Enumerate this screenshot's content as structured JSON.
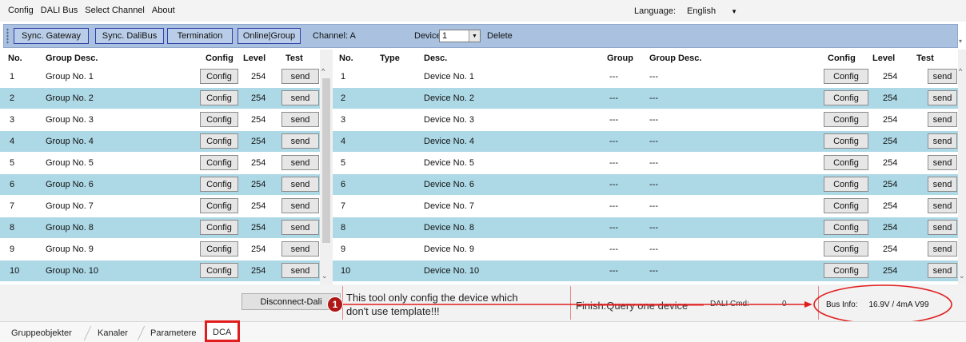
{
  "menu": [
    "Config",
    "DALI Bus",
    "Select Channel",
    "About"
  ],
  "language": {
    "label": "Language:",
    "value": "English"
  },
  "toolbar": {
    "sync_gateway": "Sync. Gateway",
    "sync_dalibus": "Sync. DaliBus",
    "termination": "Termination",
    "online_group": "Online|Group",
    "channel": "Channel:  A",
    "device_label": "Device",
    "device_value": "1",
    "delete": "Delete"
  },
  "groups": {
    "headers": {
      "no": "No.",
      "desc": "Group Desc.",
      "config": "Config",
      "level": "Level",
      "test": "Test"
    },
    "rows": [
      {
        "no": "1",
        "desc": "Group No. 1",
        "config": "Config",
        "level": "254",
        "test": "send"
      },
      {
        "no": "2",
        "desc": "Group No. 2",
        "config": "Config",
        "level": "254",
        "test": "send"
      },
      {
        "no": "3",
        "desc": "Group No. 3",
        "config": "Config",
        "level": "254",
        "test": "send"
      },
      {
        "no": "4",
        "desc": "Group No. 4",
        "config": "Config",
        "level": "254",
        "test": "send"
      },
      {
        "no": "5",
        "desc": "Group No. 5",
        "config": "Config",
        "level": "254",
        "test": "send"
      },
      {
        "no": "6",
        "desc": "Group No. 6",
        "config": "Config",
        "level": "254",
        "test": "send"
      },
      {
        "no": "7",
        "desc": "Group No. 7",
        "config": "Config",
        "level": "254",
        "test": "send"
      },
      {
        "no": "8",
        "desc": "Group No. 8",
        "config": "Config",
        "level": "254",
        "test": "send"
      },
      {
        "no": "9",
        "desc": "Group No. 9",
        "config": "Config",
        "level": "254",
        "test": "send"
      },
      {
        "no": "10",
        "desc": "Group No. 10",
        "config": "Config",
        "level": "254",
        "test": "send"
      }
    ]
  },
  "devices": {
    "headers": {
      "no": "No.",
      "type": "Type",
      "desc": "Desc.",
      "group": "Group",
      "group_desc": "Group Desc.",
      "config": "Config",
      "level": "Level",
      "test": "Test"
    },
    "rows": [
      {
        "no": "1",
        "type": "",
        "desc": "Device No. 1",
        "group": "---",
        "group_desc": "---",
        "config": "Config",
        "level": "254",
        "test": "send"
      },
      {
        "no": "2",
        "type": "",
        "desc": "Device No. 2",
        "group": "---",
        "group_desc": "---",
        "config": "Config",
        "level": "254",
        "test": "send"
      },
      {
        "no": "3",
        "type": "",
        "desc": "Device No. 3",
        "group": "---",
        "group_desc": "---",
        "config": "Config",
        "level": "254",
        "test": "send"
      },
      {
        "no": "4",
        "type": "",
        "desc": "Device No. 4",
        "group": "---",
        "group_desc": "---",
        "config": "Config",
        "level": "254",
        "test": "send"
      },
      {
        "no": "5",
        "type": "",
        "desc": "Device No. 5",
        "group": "---",
        "group_desc": "---",
        "config": "Config",
        "level": "254",
        "test": "send"
      },
      {
        "no": "6",
        "type": "",
        "desc": "Device No. 6",
        "group": "---",
        "group_desc": "---",
        "config": "Config",
        "level": "254",
        "test": "send"
      },
      {
        "no": "7",
        "type": "",
        "desc": "Device No. 7",
        "group": "---",
        "group_desc": "---",
        "config": "Config",
        "level": "254",
        "test": "send"
      },
      {
        "no": "8",
        "type": "",
        "desc": "Device No. 8",
        "group": "---",
        "group_desc": "---",
        "config": "Config",
        "level": "254",
        "test": "send"
      },
      {
        "no": "9",
        "type": "",
        "desc": "Device No. 9",
        "group": "---",
        "group_desc": "---",
        "config": "Config",
        "level": "254",
        "test": "send"
      },
      {
        "no": "10",
        "type": "",
        "desc": "Device No. 10",
        "group": "---",
        "group_desc": "---",
        "config": "Config",
        "level": "254",
        "test": "send"
      }
    ]
  },
  "status": {
    "disconnect": "Disconnect-Dali",
    "badge": "1",
    "note_line1": "This tool only config the device which",
    "note_line2": "don't use template!!!",
    "finish": "Finish:Query one device",
    "dali_cmd_label": "DALI Cmd:",
    "dali_cmd_value": "0",
    "bus_info_label": "Bus Info:",
    "bus_info_value": "16.9V / 4mA V99"
  },
  "tabs": [
    "Gruppeobjekter",
    "Kanaler",
    "Parametere",
    "DCA"
  ],
  "colors": {
    "row_alt": "#add8e6",
    "toolbar": "#aac2e0",
    "annotation_red": "#e11e1e"
  }
}
